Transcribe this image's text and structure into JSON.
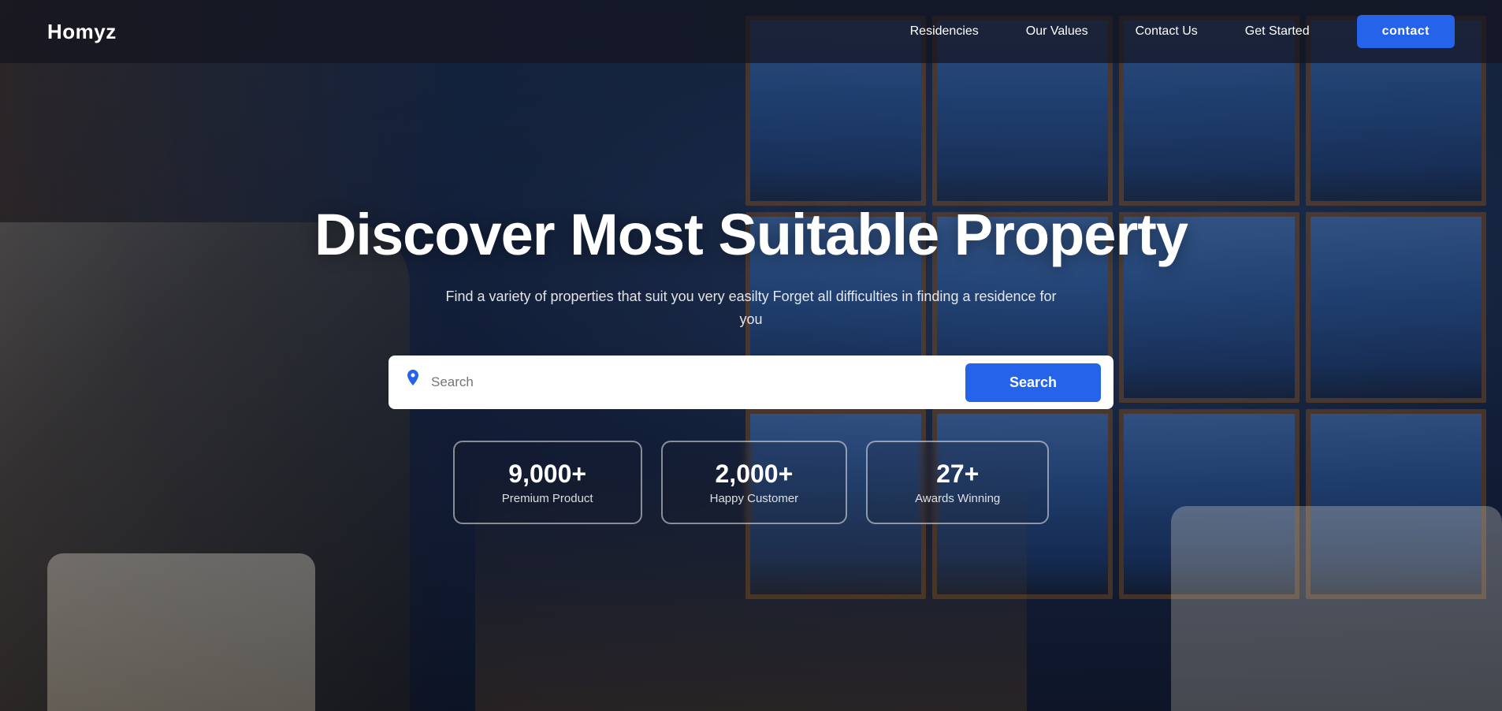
{
  "navbar": {
    "logo": "Homyz",
    "links": [
      {
        "label": "Residencies"
      },
      {
        "label": "Our Values"
      },
      {
        "label": "Contact Us"
      },
      {
        "label": "Get Started"
      }
    ],
    "contact_button": "contact"
  },
  "hero": {
    "title": "Discover Most Suitable Property",
    "subtitle": "Find a variety of properties that suit you very easilty Forget all difficulties in finding a residence for you",
    "search": {
      "placeholder": "Search",
      "button_label": "Search",
      "icon": "location-pin-icon"
    },
    "stats": [
      {
        "number": "9,000+",
        "label": "Premium Product"
      },
      {
        "number": "2,000+",
        "label": "Happy Customer"
      },
      {
        "number": "27+",
        "label": "Awards Winning"
      }
    ]
  }
}
